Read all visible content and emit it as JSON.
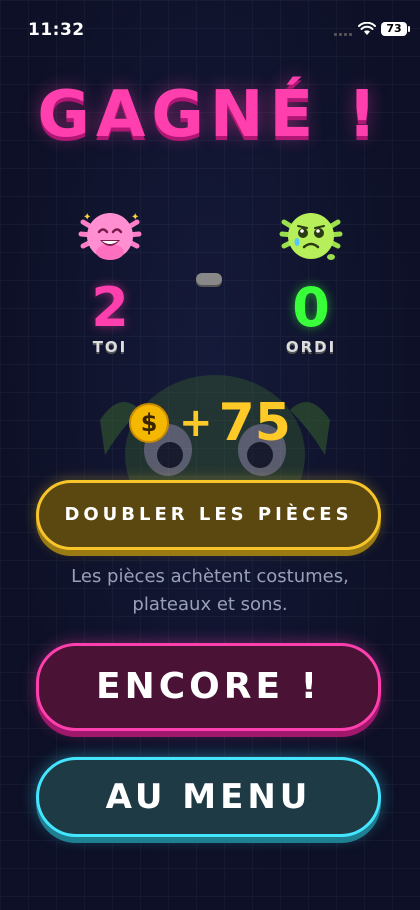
{
  "status_bar": {
    "time": "11:32",
    "battery": "73"
  },
  "title": "GAGNÉ !",
  "players": [
    {
      "score": "2",
      "label": "TOI",
      "avatar": "happy-pink-axolotl-icon"
    },
    {
      "score": "0",
      "label": "ORDI",
      "avatar": "sad-green-axolotl-icon"
    }
  ],
  "reward": {
    "coin_symbol": "$",
    "plus": "+",
    "amount": "75"
  },
  "buttons": {
    "double": "DOUBLER LES PIÈCES",
    "hint_line1": "Les pièces achètent costumes,",
    "hint_line2": "plateaux et sons.",
    "encore": "ENCORE !",
    "menu": "AU MENU"
  },
  "colors": {
    "pink": "#ff3fae",
    "green": "#39ff3a",
    "gold": "#ffc928",
    "cyan": "#44e6ff"
  }
}
